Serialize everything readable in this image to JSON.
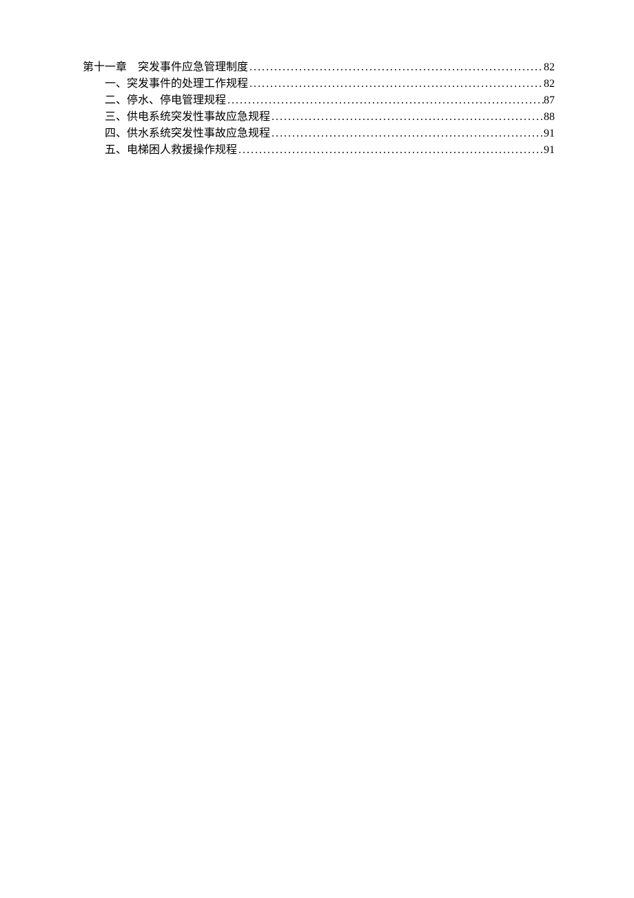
{
  "toc": {
    "entries": [
      {
        "level": 1,
        "title": "第十一章 突发事件应急管理制度",
        "page": "82"
      },
      {
        "level": 2,
        "title": "一、突发事件的处理工作规程",
        "page": "82"
      },
      {
        "level": 2,
        "title": "二、停水、停电管理规程",
        "page": "87"
      },
      {
        "level": 2,
        "title": "三、供电系统突发性事故应急规程",
        "page": "88"
      },
      {
        "level": 2,
        "title": "四、供水系统突发性事故应急规程",
        "page": "91"
      },
      {
        "level": 2,
        "title": "五、电梯困人救援操作规程",
        "page": "91"
      }
    ]
  }
}
